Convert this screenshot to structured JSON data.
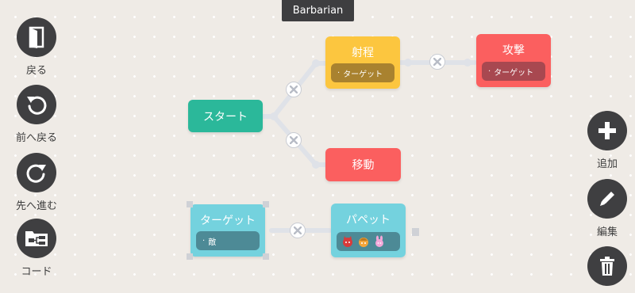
{
  "window": {
    "title": "Barbarian"
  },
  "left_toolbar": {
    "back": "戻る",
    "undo": "前へ戻る",
    "redo": "先へ進む",
    "code": "コード"
  },
  "right_toolbar": {
    "add": "追加",
    "edit": "編集"
  },
  "blocks": {
    "start": {
      "label": "スタート"
    },
    "range": {
      "label": "射程",
      "param": "ターゲット"
    },
    "attack": {
      "label": "攻撃",
      "param": "ターゲット"
    },
    "move": {
      "label": "移動"
    },
    "target": {
      "label": "ターゲット",
      "param": "敵"
    },
    "puppet": {
      "label": "パペット",
      "icons": [
        "red-demon-icon",
        "orange-knight-icon",
        "pink-bunny-icon"
      ]
    }
  },
  "colors": {
    "background": "#efebe6",
    "start": "#2bb89a",
    "range": "#fcc63f",
    "attack": "#fb5f5f",
    "move": "#fb5f5f",
    "target": "#74d2de",
    "puppet": "#74d2de",
    "dark_tool": "#3f3f41"
  }
}
